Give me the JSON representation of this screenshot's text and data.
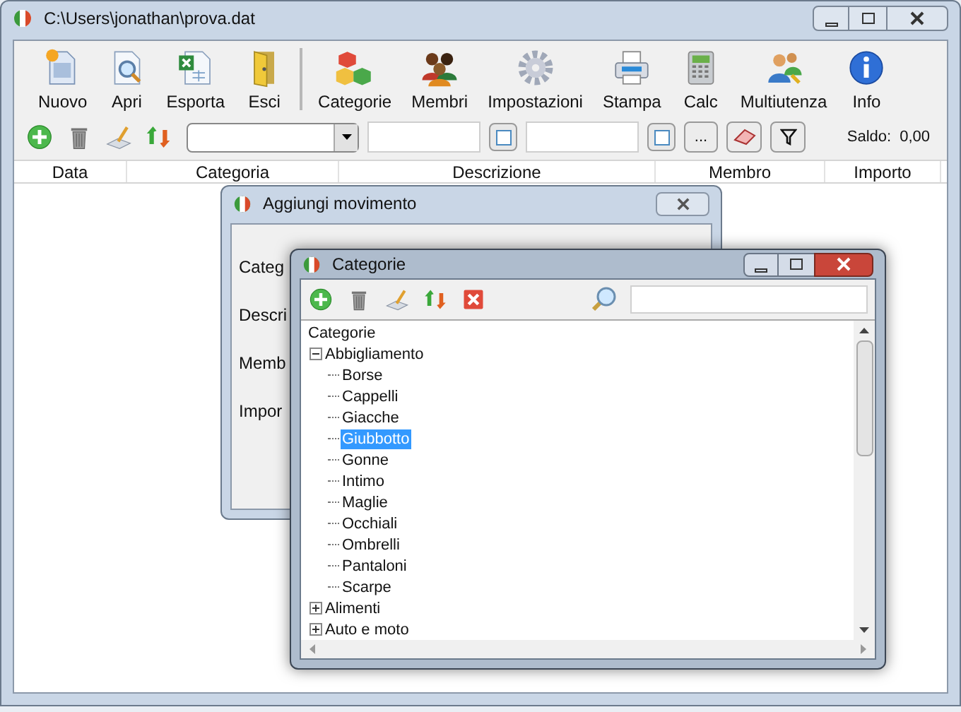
{
  "window": {
    "title": "C:\\Users\\jonathan\\prova.dat"
  },
  "toolbar": [
    {
      "label": "Nuovo",
      "kind": "new",
      "separator_before": false
    },
    {
      "label": "Apri",
      "kind": "open",
      "separator_before": false
    },
    {
      "label": "Esporta",
      "kind": "export",
      "separator_before": false
    },
    {
      "label": "Esci",
      "kind": "exit",
      "separator_before": false
    },
    {
      "label": "Categorie",
      "kind": "cubes",
      "separator_before": true
    },
    {
      "label": "Membri",
      "kind": "people",
      "separator_before": false
    },
    {
      "label": "Impostazioni",
      "kind": "gear",
      "separator_before": false
    },
    {
      "label": "Stampa",
      "kind": "printer",
      "separator_before": false
    },
    {
      "label": "Calc",
      "kind": "calc",
      "separator_before": false
    },
    {
      "label": "Multiutenza",
      "kind": "users",
      "separator_before": false
    },
    {
      "label": "Info",
      "kind": "info",
      "separator_before": false
    }
  ],
  "filter_bar": {
    "more_button": "...",
    "balance_label": "Saldo:",
    "balance": "0,00"
  },
  "table": {
    "columns": [
      "Data",
      "Categoria",
      "Descrizione",
      "Membro",
      "Importo"
    ]
  },
  "dialog": {
    "title": "Aggiungi movimento",
    "labels": [
      "Categ",
      "Descri",
      "Memb",
      "Impor"
    ]
  },
  "categories_window": {
    "title": "Categorie",
    "tree": {
      "label": "Categorie",
      "selected": false,
      "children": [
        {
          "label": "Abbigliamento",
          "expanded": true,
          "selected": false,
          "children": [
            {
              "label": "Borse",
              "selected": false
            },
            {
              "label": "Cappelli",
              "selected": false
            },
            {
              "label": "Giacche",
              "selected": false
            },
            {
              "label": "Giubbotto",
              "selected": true
            },
            {
              "label": "Gonne",
              "selected": false
            },
            {
              "label": "Intimo",
              "selected": false
            },
            {
              "label": "Maglie",
              "selected": false
            },
            {
              "label": "Occhiali",
              "selected": false
            },
            {
              "label": "Ombrelli",
              "selected": false
            },
            {
              "label": "Pantaloni",
              "selected": false
            },
            {
              "label": "Scarpe",
              "selected": false
            }
          ]
        },
        {
          "label": "Alimenti",
          "expanded": false,
          "selected": false
        },
        {
          "label": "Auto e moto",
          "expanded": false,
          "selected": false
        }
      ]
    }
  }
}
